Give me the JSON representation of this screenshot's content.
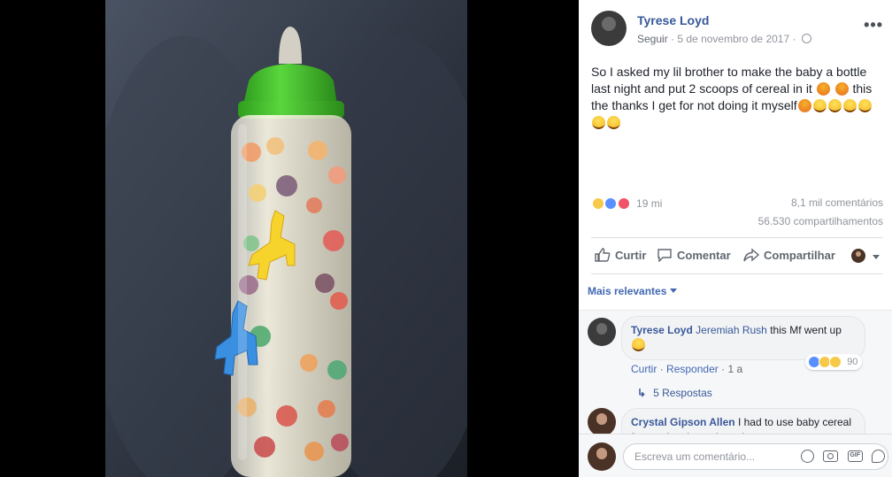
{
  "post": {
    "author": "Tyrese Loyd",
    "follow": "Seguir",
    "date": "5 de novembro de 2017",
    "separator": "·",
    "more": "•••",
    "text_part1": "So I asked my lil brother to make the baby a bottle last night and put 2 scoops of cereal in it",
    "text_part2": "this the thanks I get for not doing it myself",
    "reaction_count": "19 mi",
    "comments_count": "8,1 mil comentários",
    "shares_count": "56.530 compartilhamentos"
  },
  "actions": {
    "like": "Curtir",
    "comment": "Comentar",
    "share": "Compartilhar"
  },
  "filter": {
    "label": "Mais relevantes"
  },
  "comments": [
    {
      "author": "Tyrese Loyd",
      "mention": "Jeremiah Rush",
      "text": "this Mf went up",
      "like": "Curtir",
      "reply": "Responder",
      "time": "1 a",
      "reactions": "90",
      "replies": "5 Respostas"
    },
    {
      "author": "Crystal Gipson Allen",
      "text": "I had to use baby cereal for my daughter when she was a"
    }
  ],
  "compose": {
    "placeholder": "Escreva um comentário..."
  },
  "icons": {
    "globe": "globe-icon",
    "like": "thumbs-up-icon",
    "comment": "speech-bubble-icon",
    "share": "share-arrow-icon",
    "emoji": "smiley-icon",
    "camera": "camera-icon",
    "gif": "gif-icon",
    "sticker": "sticker-icon"
  },
  "colors": {
    "link": "#365899",
    "accent": "#4267b2",
    "muted": "#90949c",
    "bottle_cap": "#3fbf2b"
  }
}
